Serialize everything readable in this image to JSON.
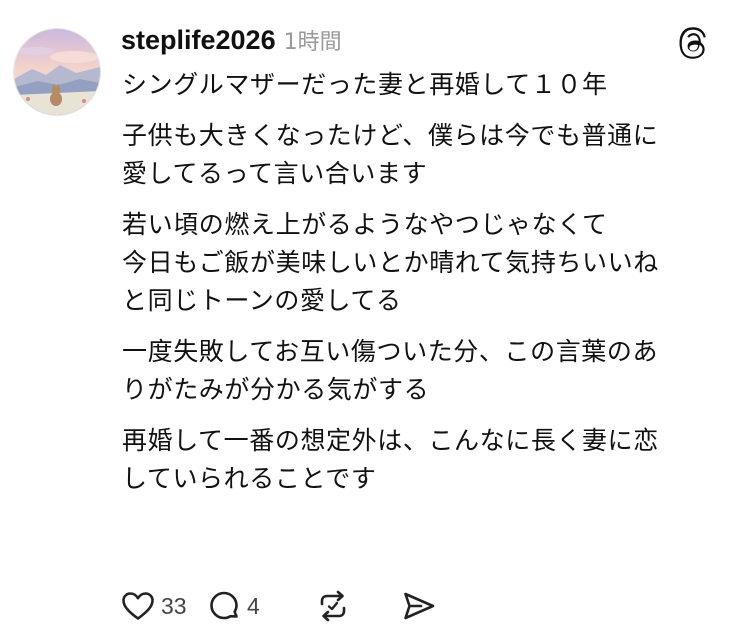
{
  "post": {
    "username": "steplife2026",
    "time": "1時間",
    "lines": [
      [
        "シングルマザーだった妻と再婚して１０年"
      ],
      [
        "子供も大きくなったけど、僕らは今でも普通に",
        "愛してるって言い合います"
      ],
      [
        "若い頃の燃え上がるようなやつじゃなくて",
        "今日もご飯が美味しいとか晴れて気持ちいいね",
        "と同じトーンの愛してる"
      ],
      [
        "一度失敗してお互い傷ついた分、この言葉のあ",
        "りがたみが分かる気がする"
      ],
      [
        "再婚して一番の想定外は、こんなに長く妻に恋",
        "していられることです"
      ]
    ]
  },
  "actions": {
    "like_count": "33",
    "reply_count": "4",
    "like_icon": "heart-icon",
    "reply_icon": "speech-bubble-icon",
    "repost_icon": "repost-arrows-icon",
    "share_icon": "send-icon"
  },
  "colors": {
    "text": "#111111",
    "muted": "#9a9a9a",
    "icon": "#222222"
  }
}
